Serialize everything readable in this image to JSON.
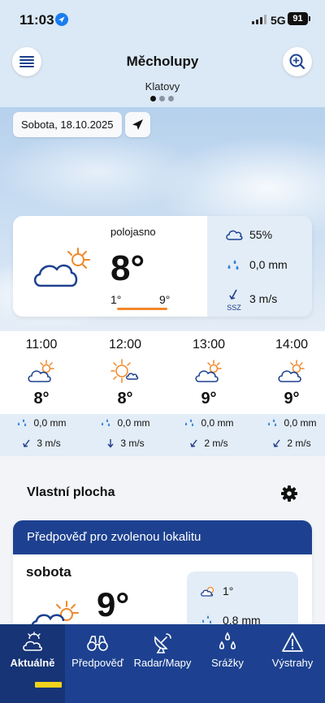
{
  "status": {
    "time": "11:03",
    "network": "5G",
    "battery": "91"
  },
  "header": {
    "city": "Měcholupy",
    "region": "Klatovy"
  },
  "date_chip": "Sobota, 18.10.2025",
  "current": {
    "condition": "polojasno",
    "temp": "8°",
    "min": "1°",
    "max": "9°",
    "cloudiness": "55%",
    "precip": "0,0 mm",
    "wind_dir": "SSZ",
    "wind_speed": "3 m/s"
  },
  "hourly": [
    {
      "time": "11:00",
      "temp": "8°",
      "rain": "0,0 mm",
      "wind": "3 m/s",
      "icon": "partly-cloudy-icon"
    },
    {
      "time": "12:00",
      "temp": "8°",
      "rain": "0,0 mm",
      "wind": "3 m/s",
      "icon": "mostly-sunny-icon"
    },
    {
      "time": "13:00",
      "temp": "9°",
      "rain": "0,0 mm",
      "wind": "2 m/s",
      "icon": "partly-cloudy-icon"
    },
    {
      "time": "14:00",
      "temp": "9°",
      "rain": "0,0 mm",
      "wind": "2 m/s",
      "icon": "partly-cloudy-icon"
    }
  ],
  "custom_section": {
    "title": "Vlastní plocha"
  },
  "forecast_card": {
    "header": "Předpověď pro zvolenou lokalitu",
    "day": "sobota",
    "temp": "9°",
    "min": "1°",
    "precip": "0,8 mm"
  },
  "tabs": [
    {
      "label": "Aktuálně",
      "icon": "sun-cloud-icon",
      "active": true
    },
    {
      "label": "Předpověď",
      "icon": "binoculars-icon",
      "active": false
    },
    {
      "label": "Radar/Mapy",
      "icon": "radar-dish-icon",
      "active": false
    },
    {
      "label": "Srážky",
      "icon": "raindrops-icon",
      "active": false
    },
    {
      "label": "Výstrahy",
      "icon": "warning-icon",
      "active": false
    }
  ],
  "colors": {
    "navy": "#1d4190",
    "accent": "#f0892b",
    "panel": "#e3edf7"
  }
}
